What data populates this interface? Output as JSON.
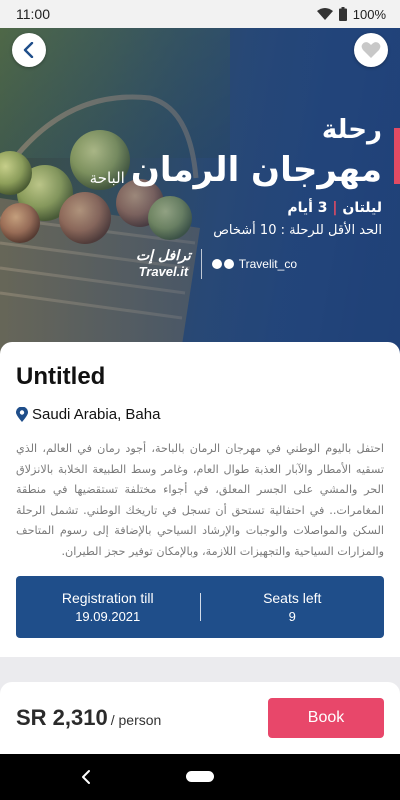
{
  "status_bar": {
    "time": "11:00",
    "battery": "100%"
  },
  "hero": {
    "title_small": "رحلة",
    "title_big": "مهرجان الرمان",
    "location": "الباحة",
    "duration_nights": "ليلتان",
    "duration_days": "3 أيام",
    "min_people": "الحد الأقل للرحلة : 10 أشخاص",
    "brand_ar": "ترافل إت",
    "brand_en": "Travel.it",
    "social_handle": "Travelit_co",
    "accent_color": "#e24b63"
  },
  "trip": {
    "title": "Untitled",
    "location": "Saudi Arabia, Baha",
    "description": "احتفل باليوم الوطني في مهرجان الرمان بالباحة، أجود رمان في العالم، الذي تسقيه الأمطار والآبار العذبة طوال العام، وغامر وسط الطبيعة الخلابة بالانزلاق الحر والمشي على الجسر المعلق، في أجواء مختلفة تستقضيها في منطقة المغامرات.. في احتفالية تستحق أن تسجل في تاريخك الوطني. تشمل الرحلة السكن والمواصلات والوجبات والإرشاد السياحي بالإضافة إلى رسوم المتاحف والمزارات السياحية والتجهيزات اللازمة، وبالإمكان توفير حجز الطيران."
  },
  "info": {
    "registration_label": "Registration till",
    "registration_value": "19.09.2021",
    "seats_label": "Seats left",
    "seats_value": "9",
    "box_color": "#1f4e8a"
  },
  "booking": {
    "price": "SR 2,310",
    "unit": "/ person",
    "button_label": "Book",
    "button_color": "#e8476a"
  }
}
